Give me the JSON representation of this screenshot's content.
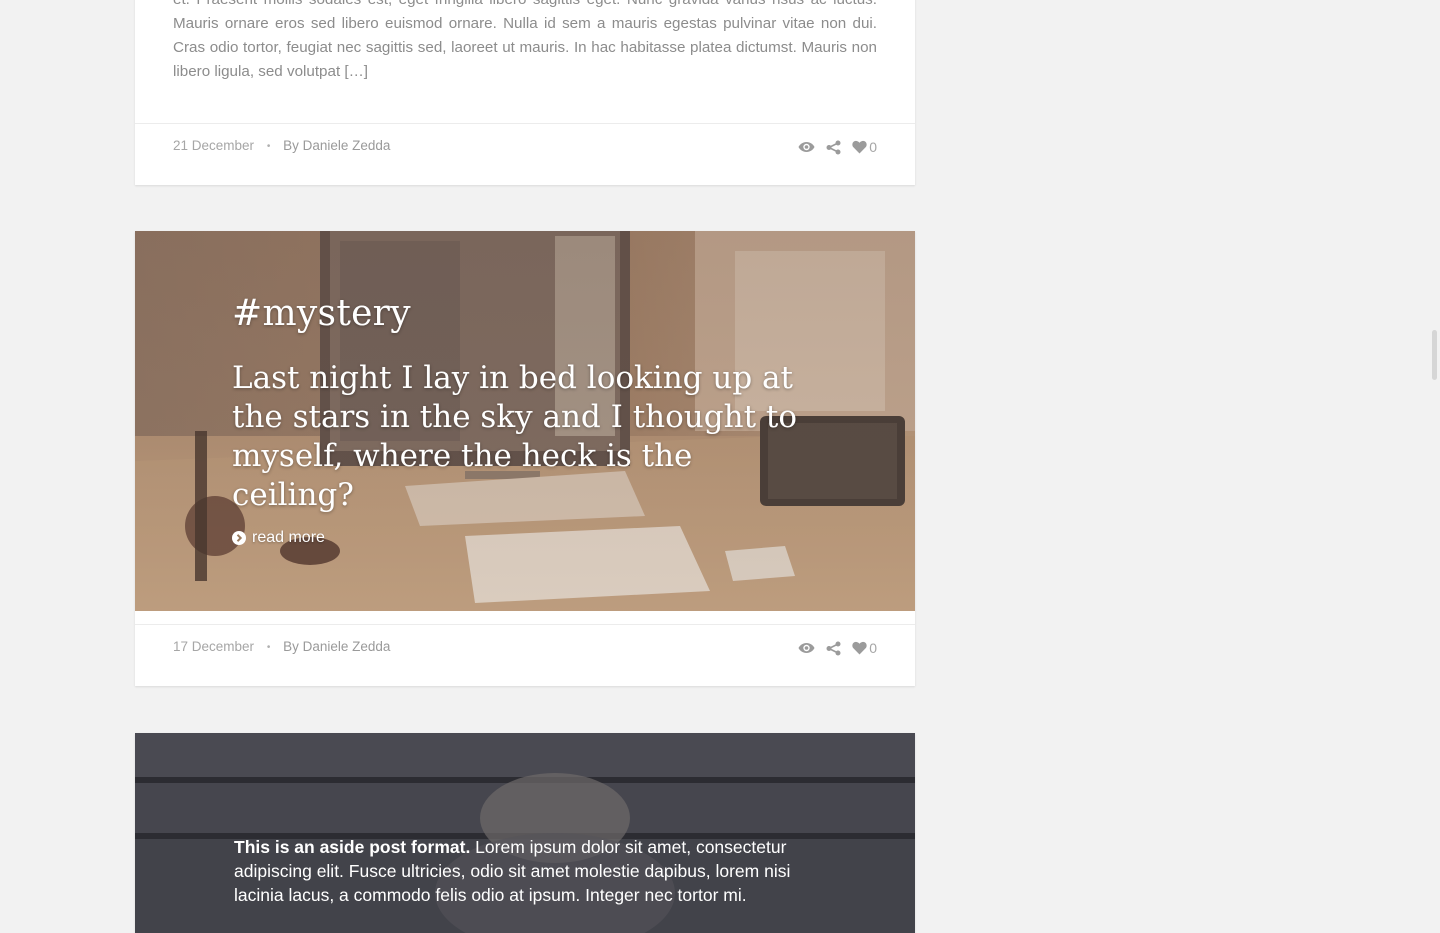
{
  "posts": [
    {
      "excerpt": "et. Praesent mollis sodales est, eget fringilla libero sagittis eget. Nunc gravida varius risus ac luctus. Mauris ornare eros sed libero euismod ornare. Nulla id sem a mauris egestas pulvinar vitae non dui. Cras odio tortor, feugiat nec sagittis sed, laoreet ut mauris. In hac habitasse platea dictumst. Mauris non libero ligula, sed volutpat […]",
      "date": "21 December",
      "separator": "•",
      "author": "By Daniele Zedda",
      "likes": "0"
    },
    {
      "tag": "#mystery",
      "quote": "Last night I lay in bed looking up at the stars in the sky and I thought to myself, where the heck is the ceiling?",
      "read_more": "read more",
      "date": "17 December",
      "separator": "•",
      "author": "By Daniele Zedda",
      "likes": "0"
    },
    {
      "aside_bold": "This is an aside post format.",
      "aside_text": " Lorem ipsum dolor sit amet, consectetur adipiscing elit. Fusce ultricies, odio sit amet molestie dapibus, lorem nisi lacinia lacus, a commodo felis odio at ipsum. Integer nec tortor mi."
    }
  ],
  "icons": {
    "views": "eye-icon",
    "share": "share-icon",
    "like": "heart-icon",
    "read_more": "chevron-circle-right-icon"
  },
  "colors": {
    "page_background": "#f2f2f2",
    "card": "#ffffff",
    "muted_text": "#8c8c8c",
    "icon": "#9b9b9b"
  }
}
